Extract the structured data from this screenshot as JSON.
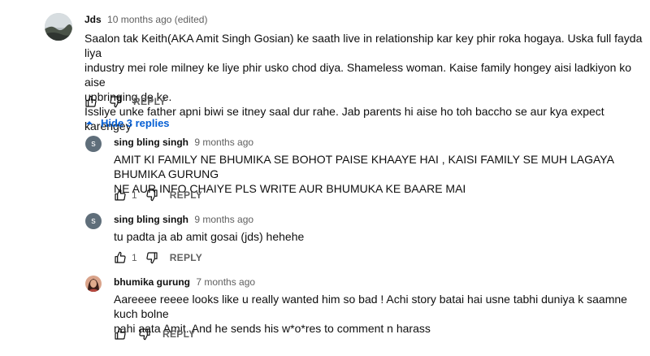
{
  "top_comment": {
    "author": "Jds",
    "time": "10 months ago (edited)",
    "lines": [
      "Saalon tak Keith(AKA Amit Singh Gosian) ke saath live in relationship kar key phir roka hogaya. Uska full fayda liya",
      "industry mei role milney ke liye phir usko chod diya. Shameless woman. Kaise family hongey aisi ladkiyon ko aise",
      "upbringing de ke.",
      "Issliye unke father apni biwi se itney saal dur rahe. Jab parents hi aise ho toh baccho se aur kya expect karengey"
    ],
    "reply_label": "REPLY"
  },
  "hide_replies_label": "Hide 3 replies",
  "replies": [
    {
      "author": "sing bling singh",
      "time": "9 months ago",
      "avatar_letter": "s",
      "lines": [
        "AMIT KI  FAMILY NE  BHUMIKA SE BOHOT PAISE KHAAYE HAI , KAISI FAMILY SE MUH LAGAYA BHUMIKA GURUNG",
        "NE AUR INFO CHAIYE PLS WRITE AUR BHUMUKA KE BAARE MAI"
      ],
      "likes": "1",
      "reply_label": "REPLY"
    },
    {
      "author": "sing bling singh",
      "time": "9 months ago",
      "avatar_letter": "s",
      "lines": [
        "tu padta ja ab amit gosai (jds) hehehe"
      ],
      "likes": "1",
      "reply_label": "REPLY"
    },
    {
      "author": "bhumika gurung",
      "time": "7 months ago",
      "lines": [
        "Aareeee reeee looks like u really wanted him so bad ! Achi story batai hai usne tabhi duniya k saamne kuch bolne",
        "nahi aata Amit. And he sends his w*o*res to comment n harass"
      ],
      "reply_label": "REPLY"
    }
  ],
  "colors": {
    "link_blue": "#065fd4",
    "meta_gray": "#606060",
    "avatar_gray": "#5f6e7a"
  },
  "icons": [
    "thumb-up-icon",
    "thumb-down-icon",
    "chevron-up-icon"
  ]
}
